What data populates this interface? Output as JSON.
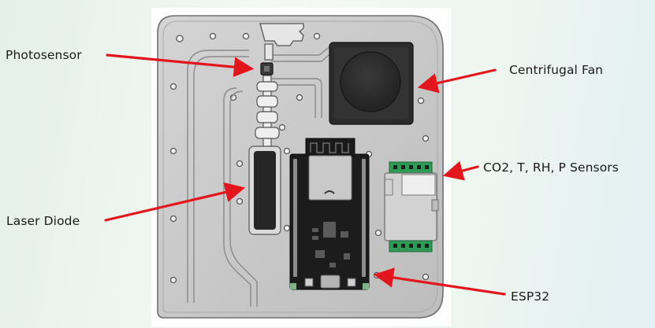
{
  "labels": {
    "photosensor": "Photosensor",
    "fan": "Centrifugal Fan",
    "sensors": "CO2, T, RH, P Sensors",
    "laser": "Laser Diode",
    "esp32": "ESP32"
  },
  "colors": {
    "arrow": "#e3161d",
    "plate": "#c7c7c7",
    "plate_edge": "#6f6f6f",
    "pcb": "#1c1c1c",
    "fan_housing": "#2b2b2b",
    "sensor_body": "#d2d2d2",
    "connector": "#2f9a55"
  }
}
